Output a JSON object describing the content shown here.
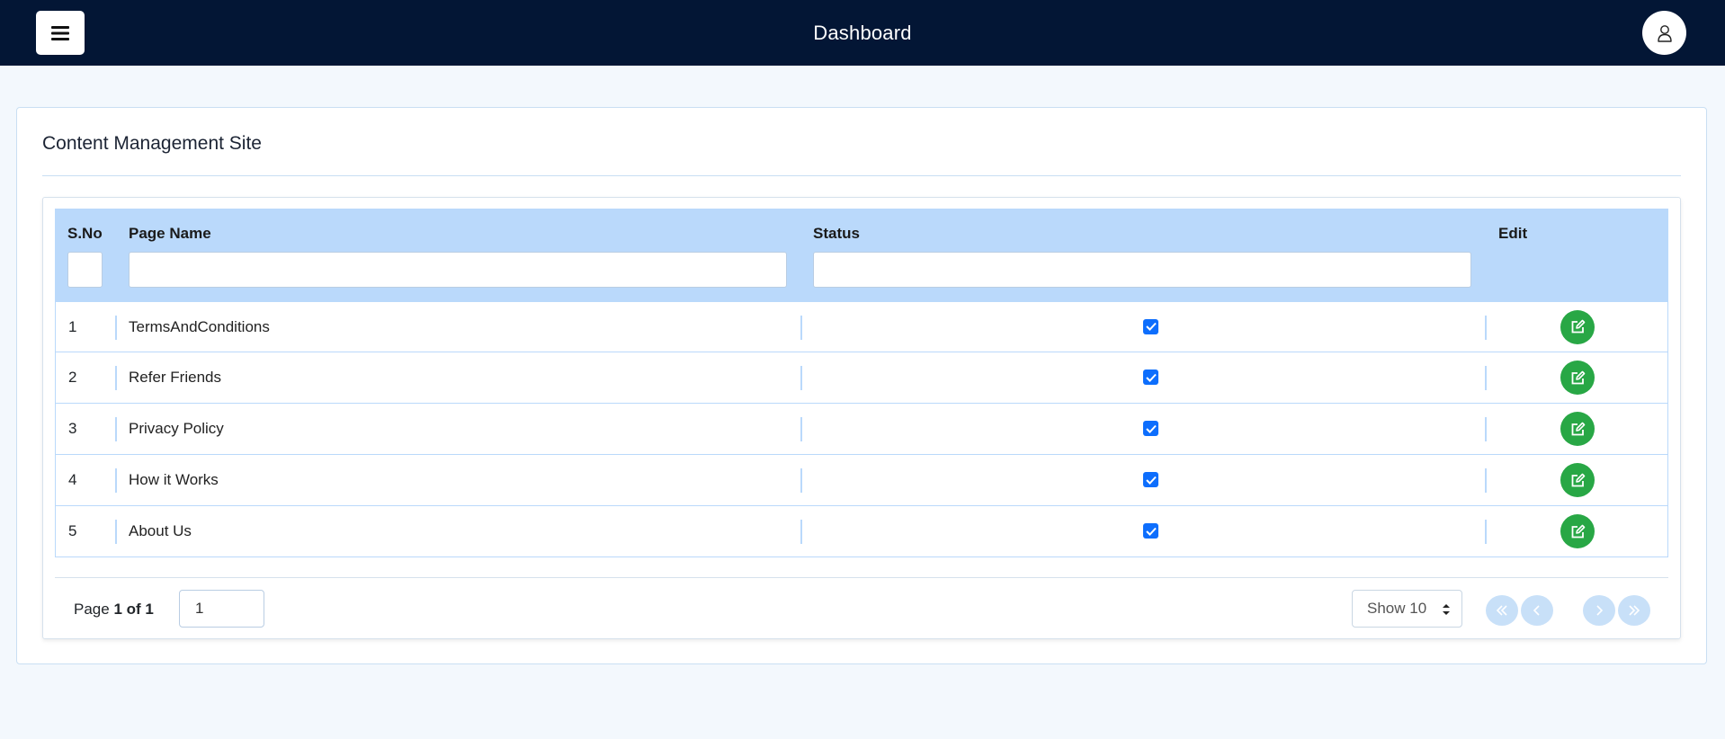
{
  "topbar": {
    "title": "Dashboard",
    "menu_icon": "hamburger-icon",
    "profile_icon": "user-icon"
  },
  "card": {
    "title": "Content Management Site"
  },
  "table": {
    "columns": {
      "sno": "S.No",
      "page_name": "Page Name",
      "status": "Status",
      "edit": "Edit"
    },
    "filters": {
      "sno": "",
      "page_name": "",
      "status": ""
    },
    "rows": [
      {
        "sno": "1",
        "page_name": "TermsAndConditions",
        "status": true
      },
      {
        "sno": "2",
        "page_name": "Refer Friends",
        "status": true
      },
      {
        "sno": "3",
        "page_name": "Privacy Policy",
        "status": true
      },
      {
        "sno": "4",
        "page_name": "How it Works",
        "status": true
      },
      {
        "sno": "5",
        "page_name": "About Us",
        "status": true
      }
    ]
  },
  "pagination": {
    "page_label": "Page",
    "page_of": "1 of 1",
    "page_input_value": "1",
    "show_label": "Show 10",
    "icons": [
      "double-chevron-left-icon",
      "chevron-left-icon",
      "chevron-right-icon",
      "double-chevron-right-icon"
    ]
  },
  "colors": {
    "topbar": "#031635",
    "header_row": "#bad9fb",
    "checkbox": "#0d6efd",
    "edit_button": "#28a745",
    "pager_button": "#c8e0f8"
  }
}
